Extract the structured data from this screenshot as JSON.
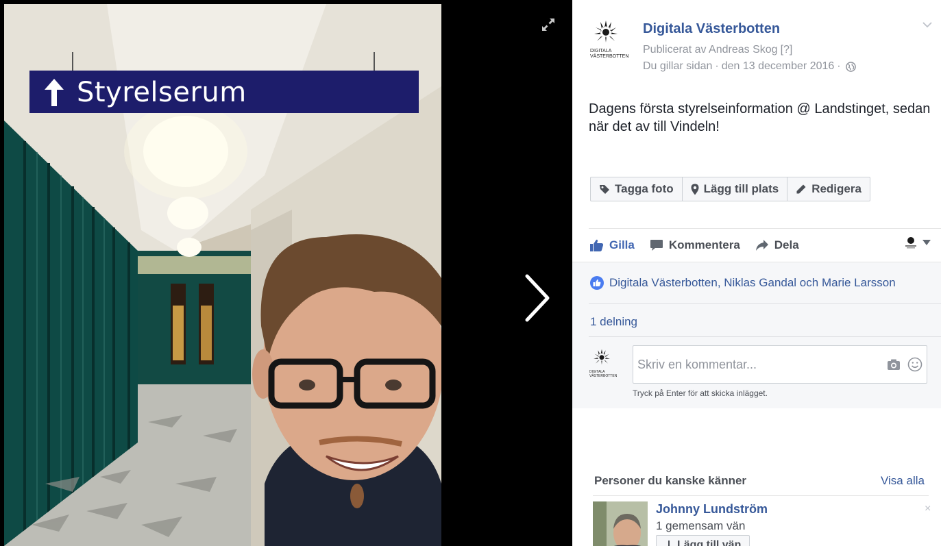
{
  "photo": {
    "sign_text": "Styrelserum",
    "sign_arrow_icon": "up-arrow-icon",
    "expand_icon": "expand-icon",
    "next_icon": "chevron-right-icon"
  },
  "post": {
    "page_name": "Digitala Västerbotten",
    "logo_text_line1": "DIGITALA",
    "logo_text_line2": "VÄSTERBOTTEN",
    "published_by": "Publicerat av Andreas Skog",
    "published_help": "[?]",
    "liked_page": "Du gillar sidan",
    "separator": "·",
    "date": "den 13 december 2016",
    "privacy_icon": "globe-icon",
    "options_icon": "chevron-down-icon",
    "text": "Dagens första styrelseinformation @ Landstinget, sedan när det av till Vindeln!"
  },
  "photo_actions": [
    {
      "label": "Tagga foto",
      "icon": "tag-icon"
    },
    {
      "label": "Lägg till plats",
      "icon": "location-pin-icon"
    },
    {
      "label": "Redigera",
      "icon": "pencil-icon"
    }
  ],
  "ufi": {
    "like_label": "Gilla",
    "comment_label": "Kommentera",
    "share_label": "Dela",
    "likers": "Digitala Västerbotten, Niklas Gandal och Marie Larsson",
    "shares": "1 delning",
    "comment_placeholder": "Skriv en kommentar...",
    "enter_hint": "Tryck på Enter för att skicka inlägget."
  },
  "pymk": {
    "title": "Personer du kanske känner",
    "see_all": "Visa alla",
    "person_name": "Johnny Lundström",
    "mutual": "1 gemensam vän",
    "add_friend": "Lägg till vän",
    "close_label": "×"
  },
  "colors": {
    "link_blue": "#365899",
    "like_blue": "#4267b2",
    "sign_blue": "#1d1d6b",
    "wall_green": "#0e4a45"
  }
}
